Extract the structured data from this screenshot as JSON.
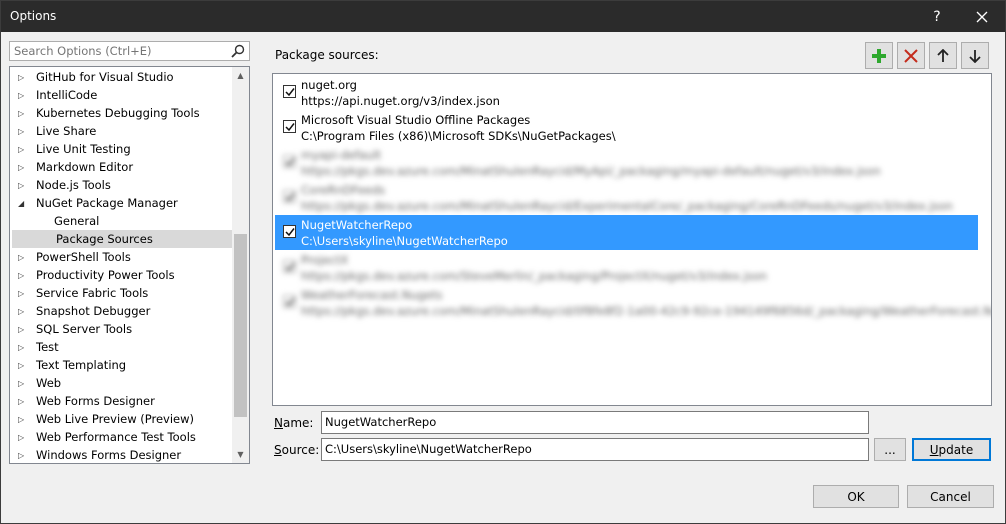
{
  "window": {
    "title": "Options",
    "help_label": "?"
  },
  "search": {
    "placeholder": "Search Options (Ctrl+E)"
  },
  "tree": {
    "items": [
      {
        "label": "GitHub for Visual Studio",
        "expandable": true,
        "child": false,
        "selected": false
      },
      {
        "label": "IntelliCode",
        "expandable": true,
        "child": false,
        "selected": false
      },
      {
        "label": "Kubernetes Debugging Tools",
        "expandable": true,
        "child": false,
        "selected": false
      },
      {
        "label": "Live Share",
        "expandable": true,
        "child": false,
        "selected": false
      },
      {
        "label": "Live Unit Testing",
        "expandable": true,
        "child": false,
        "selected": false
      },
      {
        "label": "Markdown Editor",
        "expandable": true,
        "child": false,
        "selected": false
      },
      {
        "label": "Node.js Tools",
        "expandable": true,
        "child": false,
        "selected": false
      },
      {
        "label": "NuGet Package Manager",
        "expandable": true,
        "expanded": true,
        "child": false,
        "selected": false
      },
      {
        "label": "General",
        "expandable": false,
        "child": true,
        "selected": false
      },
      {
        "label": "Package Sources",
        "expandable": false,
        "child": true,
        "selected": true
      },
      {
        "label": "PowerShell Tools",
        "expandable": true,
        "child": false,
        "selected": false
      },
      {
        "label": "Productivity Power Tools",
        "expandable": true,
        "child": false,
        "selected": false
      },
      {
        "label": "Service Fabric Tools",
        "expandable": true,
        "child": false,
        "selected": false
      },
      {
        "label": "Snapshot Debugger",
        "expandable": true,
        "child": false,
        "selected": false
      },
      {
        "label": "SQL Server Tools",
        "expandable": true,
        "child": false,
        "selected": false
      },
      {
        "label": "Test",
        "expandable": true,
        "child": false,
        "selected": false
      },
      {
        "label": "Text Templating",
        "expandable": true,
        "child": false,
        "selected": false
      },
      {
        "label": "Web",
        "expandable": true,
        "child": false,
        "selected": false
      },
      {
        "label": "Web Forms Designer",
        "expandable": true,
        "child": false,
        "selected": false
      },
      {
        "label": "Web Live Preview (Preview)",
        "expandable": true,
        "child": false,
        "selected": false
      },
      {
        "label": "Web Performance Test Tools",
        "expandable": true,
        "child": false,
        "selected": false
      },
      {
        "label": "Windows Forms Designer",
        "expandable": true,
        "child": false,
        "selected": false
      }
    ]
  },
  "package_sources": {
    "label": "Package sources:",
    "sources": [
      {
        "name": "nuget.org",
        "url": "https://api.nuget.org/v3/index.json",
        "checked": true,
        "selected": false,
        "blurred": false
      },
      {
        "name": "Microsoft Visual Studio Offline Packages",
        "url": "C:\\Program Files (x86)\\Microsoft SDKs\\NuGetPackages\\",
        "checked": true,
        "selected": false,
        "blurred": false
      },
      {
        "name": "myapi-default",
        "url": "https://pkgs.dev.azure.com/MinatShulenRaycid/MyApi/_packaging/myapi-default/nuget/v3/index.json",
        "checked": true,
        "selected": false,
        "blurred": true
      },
      {
        "name": "CoreRnDFeeds",
        "url": "https://pkgs.dev.azure.com/MinatShulenRaycid/ExperimentalCore/_packaging/CoreRnDFeeds/nuget/v3/index.json",
        "checked": true,
        "selected": false,
        "blurred": true
      },
      {
        "name": "NugetWatcherRepo",
        "url": "C:\\Users\\skyline\\NugetWatcherRepo",
        "checked": true,
        "selected": true,
        "blurred": false
      },
      {
        "name": "ProjectX",
        "url": "https://pkgs.dev.azure.com/SteveMerlin/_packaging/ProjectX/nuget/v3/index.json",
        "checked": true,
        "selected": false,
        "blurred": true
      },
      {
        "name": "WeatherForecast.Nugets",
        "url": "https://pkgs.dev.azure.com/MinatShulenRaycid/0f8fe8f2-1a00-42c9-92ce-194149f6856d/_packaging/WeatherForecast.Nug...",
        "checked": true,
        "selected": false,
        "blurred": true
      }
    ]
  },
  "form": {
    "name_label": "Name:",
    "name_value": "NugetWatcherRepo",
    "source_label": "Source:",
    "source_value": "C:\\Users\\skyline\\NugetWatcherRepo",
    "browse_label": "...",
    "update_label": "Update"
  },
  "footer": {
    "ok_label": "OK",
    "cancel_label": "Cancel"
  },
  "colors": {
    "selection": "#3399ff",
    "add_icon": "#2ea82e",
    "remove_icon": "#c42b1c",
    "titlebar": "#2b2b2b"
  }
}
